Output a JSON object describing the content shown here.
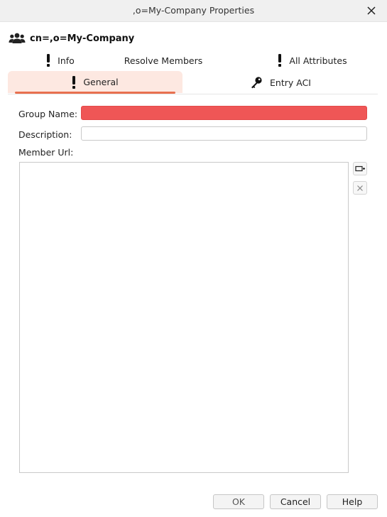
{
  "window": {
    "title": ",o=My-Company Properties",
    "close_icon": "close-icon"
  },
  "entry": {
    "icon": "group-icon",
    "title": "cn=,o=My-Company"
  },
  "tabs": {
    "info": {
      "label": "Info",
      "icon": "exclamation-icon"
    },
    "resolve_members": {
      "label": "Resolve Members"
    },
    "all_attributes": {
      "label": "All Attributes",
      "icon": "exclamation-icon"
    },
    "general": {
      "label": "General",
      "icon": "exclamation-icon",
      "selected": true
    },
    "entry_aci": {
      "label": "Entry ACI",
      "icon": "key-icon"
    }
  },
  "form": {
    "group_name_label": "Group Name:",
    "group_name_value": "",
    "description_label": "Description:",
    "description_value": "",
    "member_url_label": "Member Url:",
    "member_urls": []
  },
  "side_buttons": {
    "add_icon": "add-entry-icon",
    "remove_icon": "remove-icon"
  },
  "buttons": {
    "ok": "OK",
    "cancel": "Cancel",
    "help": "Help"
  },
  "colors": {
    "accent": "#e8704f",
    "selected_tab_bg": "#fde8e1",
    "error_field": "#ef5656"
  }
}
